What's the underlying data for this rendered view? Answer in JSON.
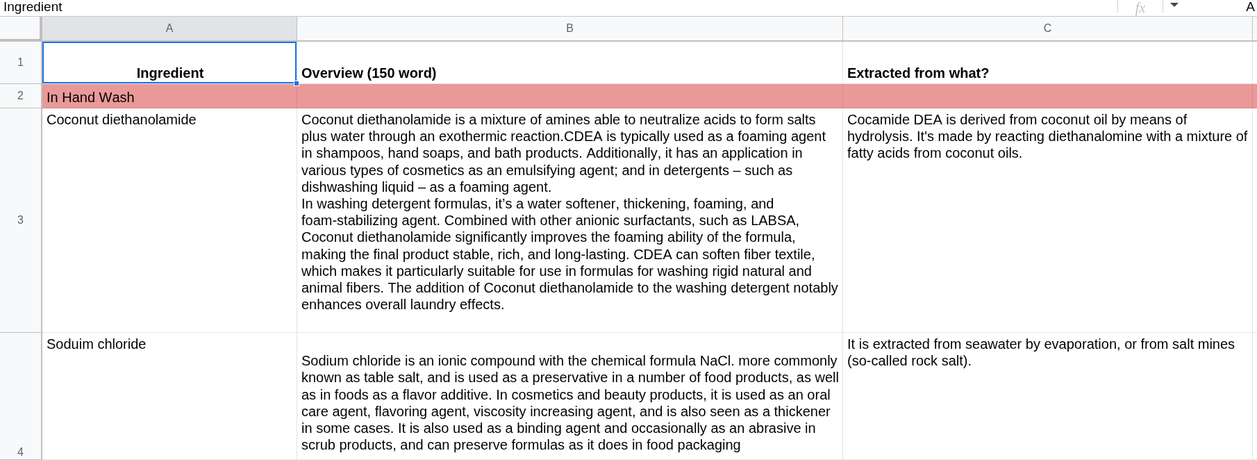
{
  "formula_bar": {
    "content": "Ingredient",
    "fx": "fx",
    "right_text": "A"
  },
  "columns": [
    {
      "letter": "A",
      "selected": true
    },
    {
      "letter": "B",
      "selected": false
    },
    {
      "letter": "C",
      "selected": false
    }
  ],
  "rows": [
    {
      "number": "1",
      "kind": "header",
      "cells": [
        {
          "text": "Ingredient",
          "selected": true
        },
        {
          "text": "Overview (150 word)",
          "selected": false
        },
        {
          "text": "Extracted from what?",
          "selected": false
        }
      ]
    },
    {
      "number": "2",
      "kind": "section",
      "cells": [
        {
          "text": "In Hand Wash",
          "selected": false
        }
      ]
    },
    {
      "number": "3",
      "kind": "entry",
      "cells": [
        {
          "text": "Coconut diethanolamide",
          "selected": false
        },
        {
          "text": "Coconut diethanolamide is a mixture of amines able to neutralize acids to form salts plus water through an exothermic reaction.CDEA is typically used as a foaming agent in shampoos, hand soaps, and bath products. Additionally, it has an application in various types of cosmetics as an emulsifying agent; and in detergents – such as dishwashing liquid – as a foaming agent.\nIn washing detergent formulas, it’s a water softener, thickening, foaming, and foam-stabilizing agent. Combined with other anionic surfactants, such as LABSA, Coconut diethanolamide significantly improves the foaming ability of the formula, making the final product stable, rich, and long-lasting. CDEA can soften fiber textile, which makes it particularly suitable for use in formulas for washing rigid natural and animal fibers. The addition of Coconut diethanolamide to the washing detergent notably enhances overall laundry effects.",
          "selected": false
        },
        {
          "text": "Cocamide DEA is derived from coconut oil by means of hydrolysis. It's made by reacting diethanalomine with a mixture of fatty acids from coconut oils.",
          "selected": false
        }
      ]
    },
    {
      "number": "4",
      "kind": "entry",
      "cells": [
        {
          "text": "Soduim chloride",
          "selected": false
        },
        {
          "text": "\nSodium chloride is an ionic compound with the chemical formula NaCl. more commonly known as table salt, and is used as a preservative in a number of food products, as well as in foods as a flavor additive. In cosmetics and beauty products, it is used as an oral care agent, flavoring agent, viscosity increasing agent, and is also seen as a thickener in some cases. It is also used as a binding agent and occasionally as an abrasive in scrub products, and can preserve formulas as it does in food packaging",
          "selected": false
        },
        {
          "text": "It is extracted from seawater by evaporation, or from salt mines (so-called rock salt).",
          "selected": false
        }
      ]
    }
  ]
}
